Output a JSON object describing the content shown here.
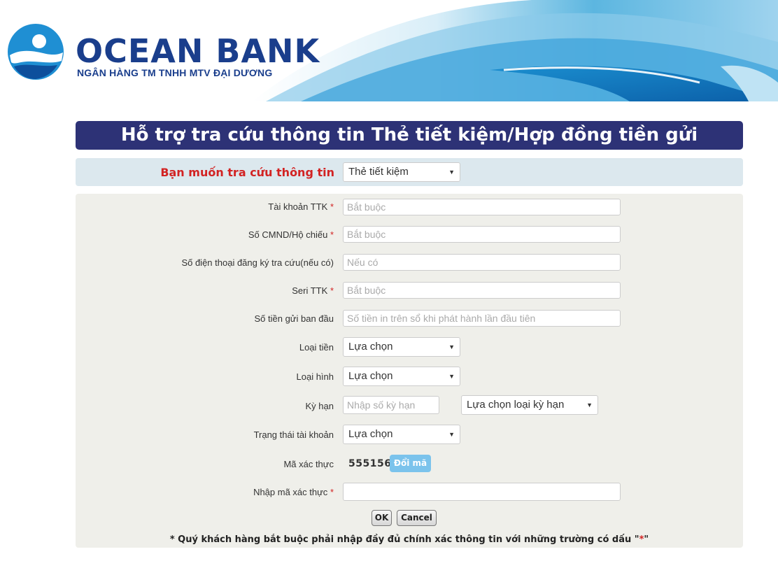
{
  "brand": {
    "name": "OCEAN BANK",
    "subtitle": "NGÂN HÀNG TM TNHH MTV ĐẠI DƯƠNG"
  },
  "page_title": "Hỗ trợ tra cứu thông tin Thẻ tiết kiệm/Hợp đồng tiền gửi",
  "lookup": {
    "question": "Bạn muốn tra cứu thông tin",
    "selected": "Thẻ tiết kiệm"
  },
  "form": {
    "account": {
      "label": "Tài khoản TTK",
      "required": "*",
      "placeholder": "Bắt buộc",
      "value": ""
    },
    "id_number": {
      "label": "Số CMND/Hộ chiếu",
      "required": "*",
      "placeholder": "Bắt buộc",
      "value": ""
    },
    "phone": {
      "label": "Số điện thoại đăng ký tra cứu(nếu có)",
      "placeholder": "Nếu có",
      "value": ""
    },
    "serial": {
      "label": "Seri TTK",
      "required": "*",
      "placeholder": "Bắt buộc",
      "value": ""
    },
    "initial_amount": {
      "label": "Số tiền gửi ban đầu",
      "placeholder": "Số tiền in trên sổ khi phát hành lần đầu tiên",
      "value": ""
    },
    "currency": {
      "label": "Loại tiền",
      "selected": "Lựa chọn"
    },
    "type": {
      "label": "Loại hình",
      "selected": "Lựa chọn"
    },
    "term": {
      "label": "Kỳ hạn",
      "placeholder": "Nhập số kỳ hạn",
      "value": "",
      "unit_selected": "Lựa chọn loại kỳ hạn"
    },
    "status": {
      "label": "Trạng thái tài khoản",
      "selected": "Lựa chọn"
    },
    "captcha": {
      "label": "Mã xác thực",
      "code": "555156",
      "refresh_label": "Đổi mã"
    },
    "captcha_input": {
      "label": "Nhập mã xác thực",
      "required": "*",
      "value": ""
    }
  },
  "buttons": {
    "ok": "OK",
    "cancel": "Cancel"
  },
  "note": {
    "text": "* Quý khách hàng bắt buộc phải nhập đầy đủ chính xác thông tin với những trường có dấu \"",
    "star": "*",
    "end": "\""
  },
  "colors": {
    "title_bar": "#2d3276",
    "brand_blue": "#1a3e8c",
    "required_red": "#d22323",
    "refresh_button": "#7bc3ec"
  }
}
